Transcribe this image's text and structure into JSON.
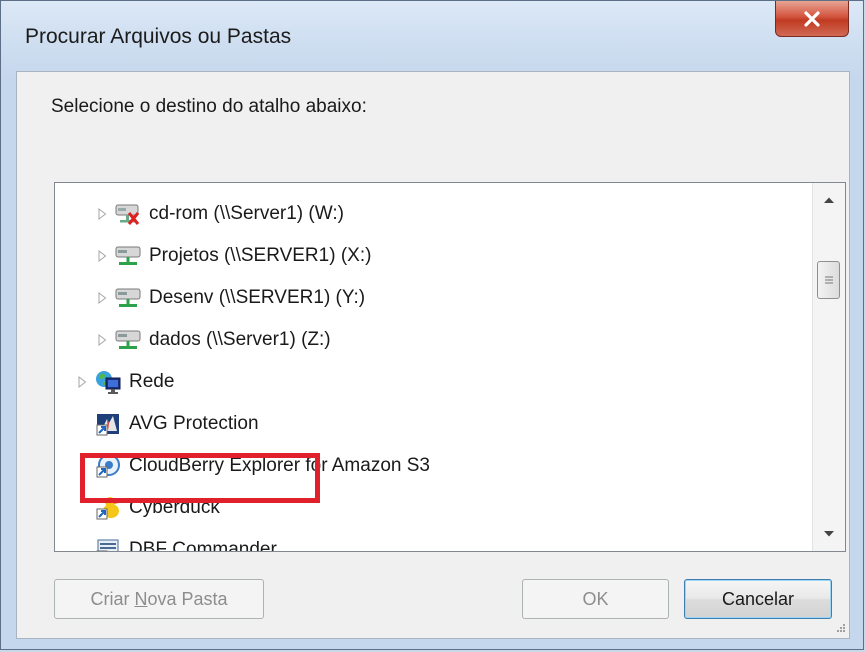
{
  "window": {
    "title": "Procurar Arquivos ou Pastas",
    "close_label": "x"
  },
  "dialog": {
    "instruction": "Selecione o destino do atalho abaixo:"
  },
  "tree": {
    "items": [
      {
        "label": "cd-rom (\\\\Server1) (W:)",
        "icon": "disconnected-network-drive-icon",
        "expandable": true
      },
      {
        "label": "Projetos (\\\\SERVER1) (X:)",
        "icon": "network-drive-icon",
        "expandable": true
      },
      {
        "label": "Desenv (\\\\SERVER1) (Y:)",
        "icon": "network-drive-icon",
        "expandable": true
      },
      {
        "label": "dados (\\\\Server1) (Z:)",
        "icon": "network-drive-icon",
        "expandable": true
      },
      {
        "label": "Rede",
        "icon": "network-globe-icon",
        "expandable": true
      },
      {
        "label": "AVG Protection",
        "icon": "avg-shortcut-icon",
        "expandable": false
      },
      {
        "label": "CloudBerry Explorer for Amazon S3",
        "icon": "cloudberry-shortcut-icon",
        "expandable": false
      },
      {
        "label": "Cyberduck",
        "icon": "cyberduck-shortcut-icon",
        "expandable": false
      },
      {
        "label": "DBF Commander",
        "icon": "dbf-shortcut-icon",
        "expandable": false
      }
    ]
  },
  "buttons": {
    "new_folder_pre": "Criar ",
    "new_folder_accel": "N",
    "new_folder_post": "ova Pasta",
    "ok": "OK",
    "cancel": "Cancelar"
  },
  "colors": {
    "highlight": "#e0202a",
    "close_button": "#c13a22"
  }
}
